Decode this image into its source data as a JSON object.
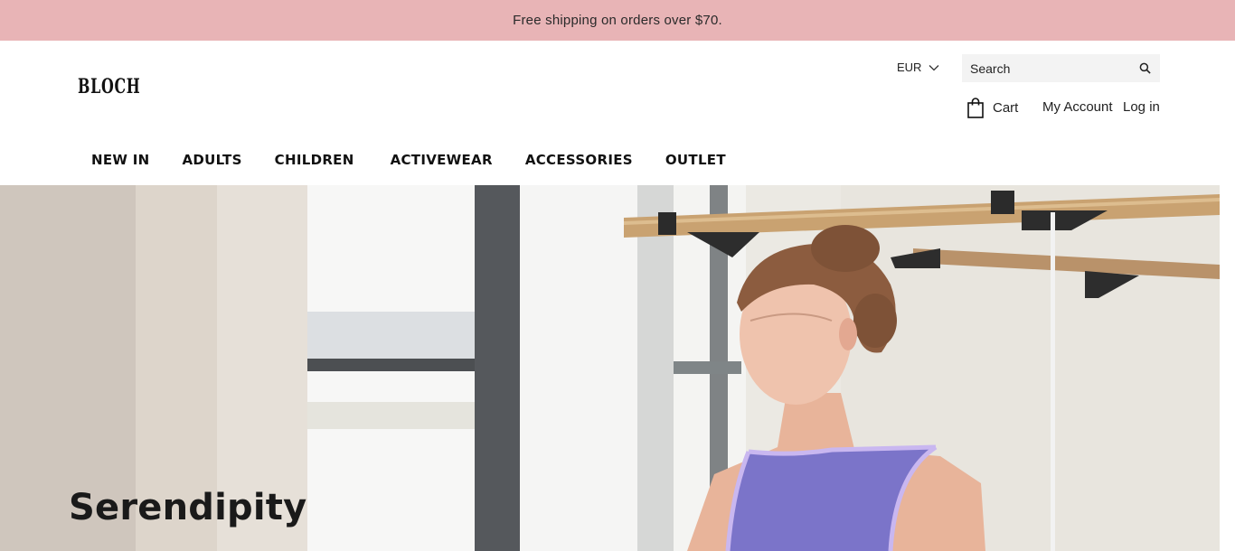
{
  "announcement": {
    "text": "Free shipping on orders over $70."
  },
  "header": {
    "logo": "BLOCH",
    "currency": "EUR",
    "search": {
      "placeholder": "Search"
    },
    "cart_label": "Cart",
    "account_label": "My Account",
    "login_label": "Log in"
  },
  "nav": {
    "items": [
      "NEW IN",
      "ADULTS",
      "CHILDREN",
      "ACTIVEWEAR",
      "ACCESSORIES",
      "OUTLET"
    ]
  },
  "hero": {
    "title": "Serendipity",
    "leotard_color": "#7b74c9",
    "trim_color": "#c9b7f0",
    "barre_color": "#c9a271"
  },
  "colors": {
    "announcement_bg": "#e8b4b6",
    "text": "#121212"
  },
  "icons": {
    "currency": "chevron-down-icon",
    "search": "search-icon",
    "cart": "shopping-bag-icon"
  }
}
